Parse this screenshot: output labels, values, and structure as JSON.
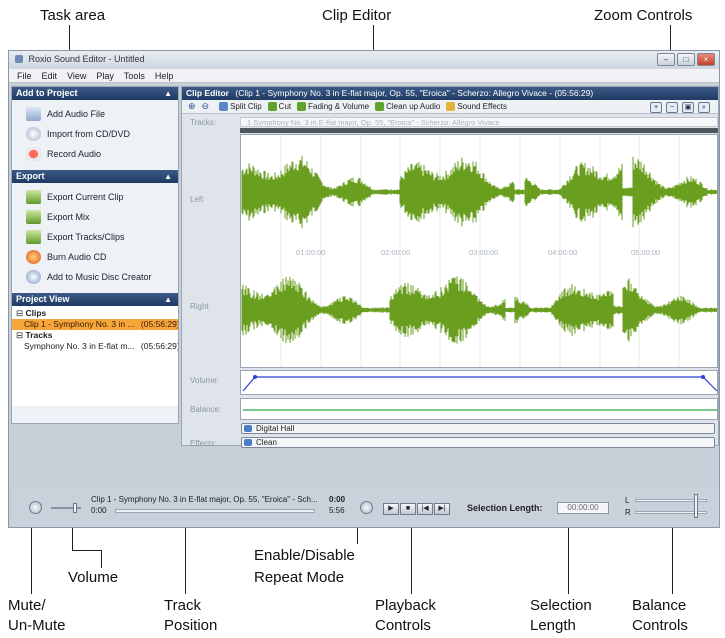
{
  "window": {
    "title": "Roxio Sound Editor - Untitled",
    "controls": {
      "minimize": "–",
      "maximize": "□",
      "close": "×"
    }
  },
  "menu": [
    "File",
    "Edit",
    "View",
    "Play",
    "Tools",
    "Help"
  ],
  "task_area": {
    "add_to_project": {
      "title": "Add to Project",
      "items": [
        "Add Audio File",
        "Import from CD/DVD",
        "Record Audio"
      ]
    },
    "export": {
      "title": "Export",
      "items": [
        "Export Current Clip",
        "Export Mix",
        "Export Tracks/Clips",
        "Burn Audio CD",
        "Add to Music Disc Creator"
      ]
    },
    "project_view": {
      "title": "Project View",
      "clips_label": "Clips",
      "clip_item_name": "Clip 1 - Symphony No. 3 in ...",
      "clip_item_time": "(05:56:29)",
      "tracks_label": "Tracks",
      "track_item_name": "Symphony No. 3 in E-flat m...",
      "track_item_time": "(05:56:29)"
    }
  },
  "clip_editor": {
    "title": "Clip Editor",
    "clip_info": "(Clip 1 - Symphony No. 3 in E-flat major, Op. 55, \"Eroica\" - Scherzo: Allegro Vivace - (05:56:29)",
    "toolbar": [
      "Split Clip",
      "Cut",
      "Fading & Volume",
      "Clean up Audio",
      "Sound Effects"
    ],
    "tracks_label": "Tracks:",
    "tracks_strip": "1 Symphony No. 3 in E-flat major, Op. 55, \"Eroica\" - Scherzo: Allegro Vivace",
    "left_label": "Left",
    "right_label": "Right",
    "volume_label": "Volume:",
    "balance_label": "Balance:",
    "effects_label": "Effects:",
    "time_ticks": [
      "01:00:00",
      "02:00:00",
      "03:00:00",
      "04:00:00",
      "05:00:00"
    ],
    "effects": [
      "Digital Hall",
      "Clean"
    ]
  },
  "bottom_bar": {
    "now_playing": "Clip 1 - Symphony No. 3 in E-flat major, Op. 55, \"Eroica\" - Sch...",
    "position_start": "0:00",
    "position_current": "0:00",
    "position_end": "5:56",
    "selection_length_label": "Selection Length:",
    "selection_length_value": "00:00:00",
    "balance_l": "L",
    "balance_r": "R"
  },
  "callouts": {
    "task_area": "Task area",
    "clip_editor": "Clip Editor",
    "zoom_controls": "Zoom Controls",
    "mute": [
      "Mute/",
      "Un-Mute"
    ],
    "volume": "Volume",
    "repeat": [
      "Enable/Disable",
      "Repeat Mode"
    ],
    "track_position": [
      "Track",
      "Position"
    ],
    "playback": [
      "Playback",
      "Controls"
    ],
    "selection_length": [
      "Selection",
      "Length"
    ],
    "balance": [
      "Balance",
      "Controls"
    ]
  },
  "colors": {
    "waveform": "#6a9e1f",
    "header_blue": "#24416b",
    "selection_orange": "#f5a53a",
    "volume_line": "#2a3fd4",
    "balance_line": "#2aa640"
  }
}
